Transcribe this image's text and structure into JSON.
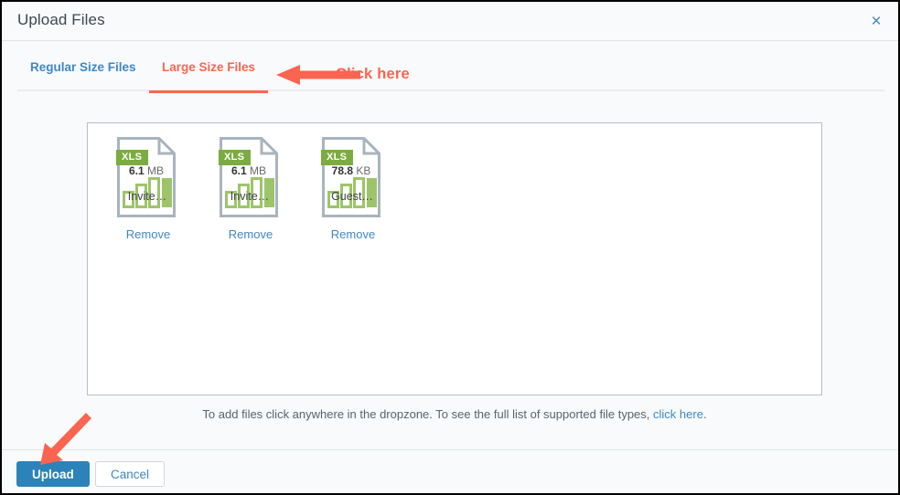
{
  "dialog": {
    "title": "Upload Files",
    "close_icon": "close-icon",
    "close_glyph": "×"
  },
  "tabs": [
    {
      "label": "Regular Size Files",
      "active": false
    },
    {
      "label": "Large Size Files",
      "active": true
    }
  ],
  "annotations": [
    {
      "name": "click-here-annotation",
      "label": "Click here",
      "icon": "left-arrow-icon",
      "color": "#fa6450"
    },
    {
      "name": "upload-button-annotation",
      "label": "",
      "icon": "down-left-arrow-icon",
      "color": "#fa6450"
    }
  ],
  "dropzone": {
    "name": "file-dropzone",
    "files": [
      {
        "type_badge": "XLS",
        "size_value": "6.1",
        "size_unit": "MB",
        "name": "Invite…",
        "remove_label": "Remove",
        "icon": "xls-file-icon"
      },
      {
        "type_badge": "XLS",
        "size_value": "6.1",
        "size_unit": "MB",
        "name": "Invite…",
        "remove_label": "Remove",
        "icon": "xls-file-icon"
      },
      {
        "type_badge": "XLS",
        "size_value": "78.8",
        "size_unit": "KB",
        "name": "Guest…",
        "remove_label": "Remove",
        "icon": "xls-file-icon"
      }
    ]
  },
  "hint": {
    "text": "To add files click anywhere in the dropzone. To see the full list of supported file types, ",
    "link_text": "click here",
    "suffix": "."
  },
  "footer": {
    "upload_label": "Upload",
    "cancel_label": "Cancel"
  },
  "colors": {
    "accent_blue": "#2b83b9",
    "link_blue": "#3f87c4",
    "tab_active": "#f8674f",
    "annotation_red": "#fa6450",
    "xls_green": "#7cab42",
    "dialog_bg": "#f8fafb"
  }
}
